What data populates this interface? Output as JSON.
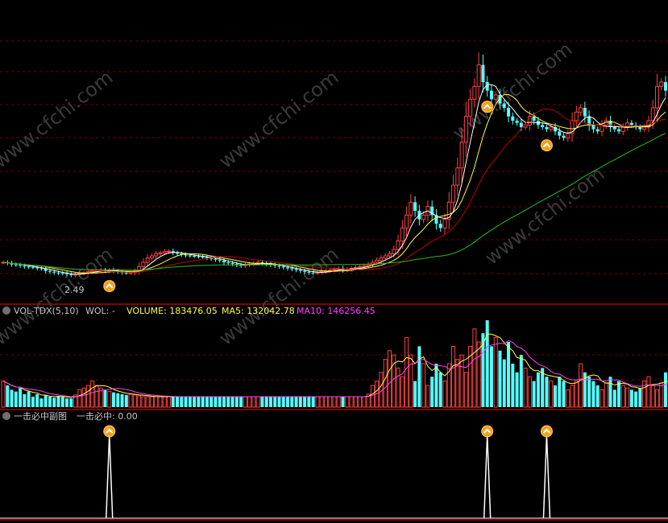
{
  "colors": {
    "background": "#000000",
    "grid": "#7a0000",
    "separator": "#b00000",
    "up": "#ff4040",
    "down": "#54ffff",
    "ma_white": "#ffffff",
    "ma_yellow": "#ffff40",
    "ma_red": "#c00000",
    "ma_green": "#20c020",
    "vol_ma5": "#ffff40",
    "vol_ma10": "#ff40ff",
    "header_text": "#c8c8c8",
    "signal": "#ffffff"
  },
  "watermark": "www.cfchi.com",
  "price_panel": {
    "low_marker": "2.49",
    "price_range": [
      1.9,
      8.5
    ]
  },
  "volume_panel": {
    "indicator": "VOL-TDX(5,10)",
    "wol": "WOL: -",
    "volume_label": "VOLUME: 183476.05",
    "ma5_label": "MA5: 132042.78",
    "ma10_label": "MA10: 146256.45"
  },
  "signal_panel": {
    "title": "一击必中副图",
    "value_label": "一击必中: 0.00"
  },
  "chart_data": [
    {
      "type": "candlestick",
      "panel": "price",
      "series": [
        "白线(短期均线)",
        "黄线",
        "红线",
        "绿线"
      ],
      "close": [
        2.8,
        2.78,
        2.75,
        2.74,
        2.72,
        2.7,
        2.69,
        2.68,
        2.66,
        2.65,
        2.6,
        2.58,
        2.56,
        2.55,
        2.54,
        2.52,
        2.5,
        2.52,
        2.55,
        2.56,
        2.58,
        2.6,
        2.6,
        2.62,
        2.6,
        2.62,
        2.6,
        2.58,
        2.56,
        2.55,
        2.56,
        2.6,
        2.7,
        2.8,
        2.9,
        2.95,
        3.0,
        3.02,
        3.05,
        3.06,
        3.02,
        3.0,
        2.98,
        2.96,
        2.95,
        2.94,
        2.93,
        2.92,
        2.9,
        2.88,
        2.86,
        2.84,
        2.8,
        2.78,
        2.76,
        2.74,
        2.72,
        2.74,
        2.76,
        2.78,
        2.8,
        2.78,
        2.76,
        2.74,
        2.72,
        2.7,
        2.68,
        2.66,
        2.64,
        2.62,
        2.6,
        2.58,
        2.56,
        2.55,
        2.56,
        2.58,
        2.6,
        2.62,
        2.64,
        2.66,
        2.62,
        2.64,
        2.66,
        2.68,
        2.7,
        2.72,
        2.75,
        2.8,
        2.85,
        2.9,
        2.95,
        3.0,
        3.1,
        3.3,
        3.6,
        3.9,
        4.2,
        4.0,
        3.8,
        3.9,
        4.1,
        3.9,
        3.7,
        3.6,
        3.8,
        4.2,
        4.6,
        5.0,
        5.6,
        6.2,
        6.6,
        6.9,
        7.4,
        7.0,
        6.8,
        6.6,
        6.7,
        6.5,
        6.4,
        6.2,
        6.1,
        6.05,
        5.95,
        6.0,
        6.2,
        6.1,
        6.0,
        5.95,
        5.9,
        5.95,
        5.85,
        5.75,
        5.7,
        5.8,
        6.1,
        6.3,
        6.4,
        6.2,
        6.0,
        5.9,
        5.85,
        6.0,
        6.1,
        5.95,
        5.9,
        5.85,
        5.95,
        6.05,
        6.0,
        5.95,
        5.9,
        5.95,
        6.1,
        6.4,
        6.9,
        7.0,
        6.8
      ]
    },
    {
      "type": "bar",
      "panel": "volume",
      "name": "VOLUME",
      "series": [
        "MA5",
        "MA10"
      ],
      "values": [
        30,
        25,
        20,
        18,
        22,
        15,
        18,
        12,
        15,
        10,
        14,
        12,
        11,
        13,
        12,
        10,
        10,
        14,
        20,
        22,
        25,
        30,
        25,
        22,
        20,
        18,
        17,
        16,
        15,
        14,
        15,
        14,
        13,
        12,
        12,
        12,
        12,
        12,
        12,
        12,
        12,
        12,
        12,
        12,
        12,
        12,
        12,
        12,
        12,
        12,
        12,
        12,
        12,
        12,
        12,
        12,
        12,
        12,
        12,
        12,
        12,
        12,
        12,
        12,
        12,
        12,
        12,
        12,
        12,
        12,
        12,
        12,
        12,
        12,
        12,
        12,
        12,
        12,
        12,
        12,
        12,
        12,
        12,
        12,
        12,
        12,
        15,
        25,
        30,
        40,
        55,
        65,
        60,
        45,
        35,
        80,
        60,
        30,
        70,
        50,
        25,
        35,
        50,
        40,
        30,
        50,
        70,
        55,
        60,
        40,
        70,
        90,
        75,
        85,
        100,
        70,
        80,
        65,
        55,
        75,
        50,
        40,
        60,
        45,
        35,
        30,
        40,
        45,
        35,
        30,
        25,
        35,
        30,
        20,
        25,
        30,
        50,
        40,
        35,
        30,
        25,
        20,
        28,
        35,
        20,
        30,
        25,
        22,
        20,
        18,
        22,
        30,
        35,
        25,
        20,
        28,
        40,
        35,
        30
      ]
    },
    {
      "type": "line",
      "panel": "signal",
      "name": "一击必中",
      "signal_indices": [
        25,
        114,
        128
      ],
      "signal_value": 1
    }
  ]
}
